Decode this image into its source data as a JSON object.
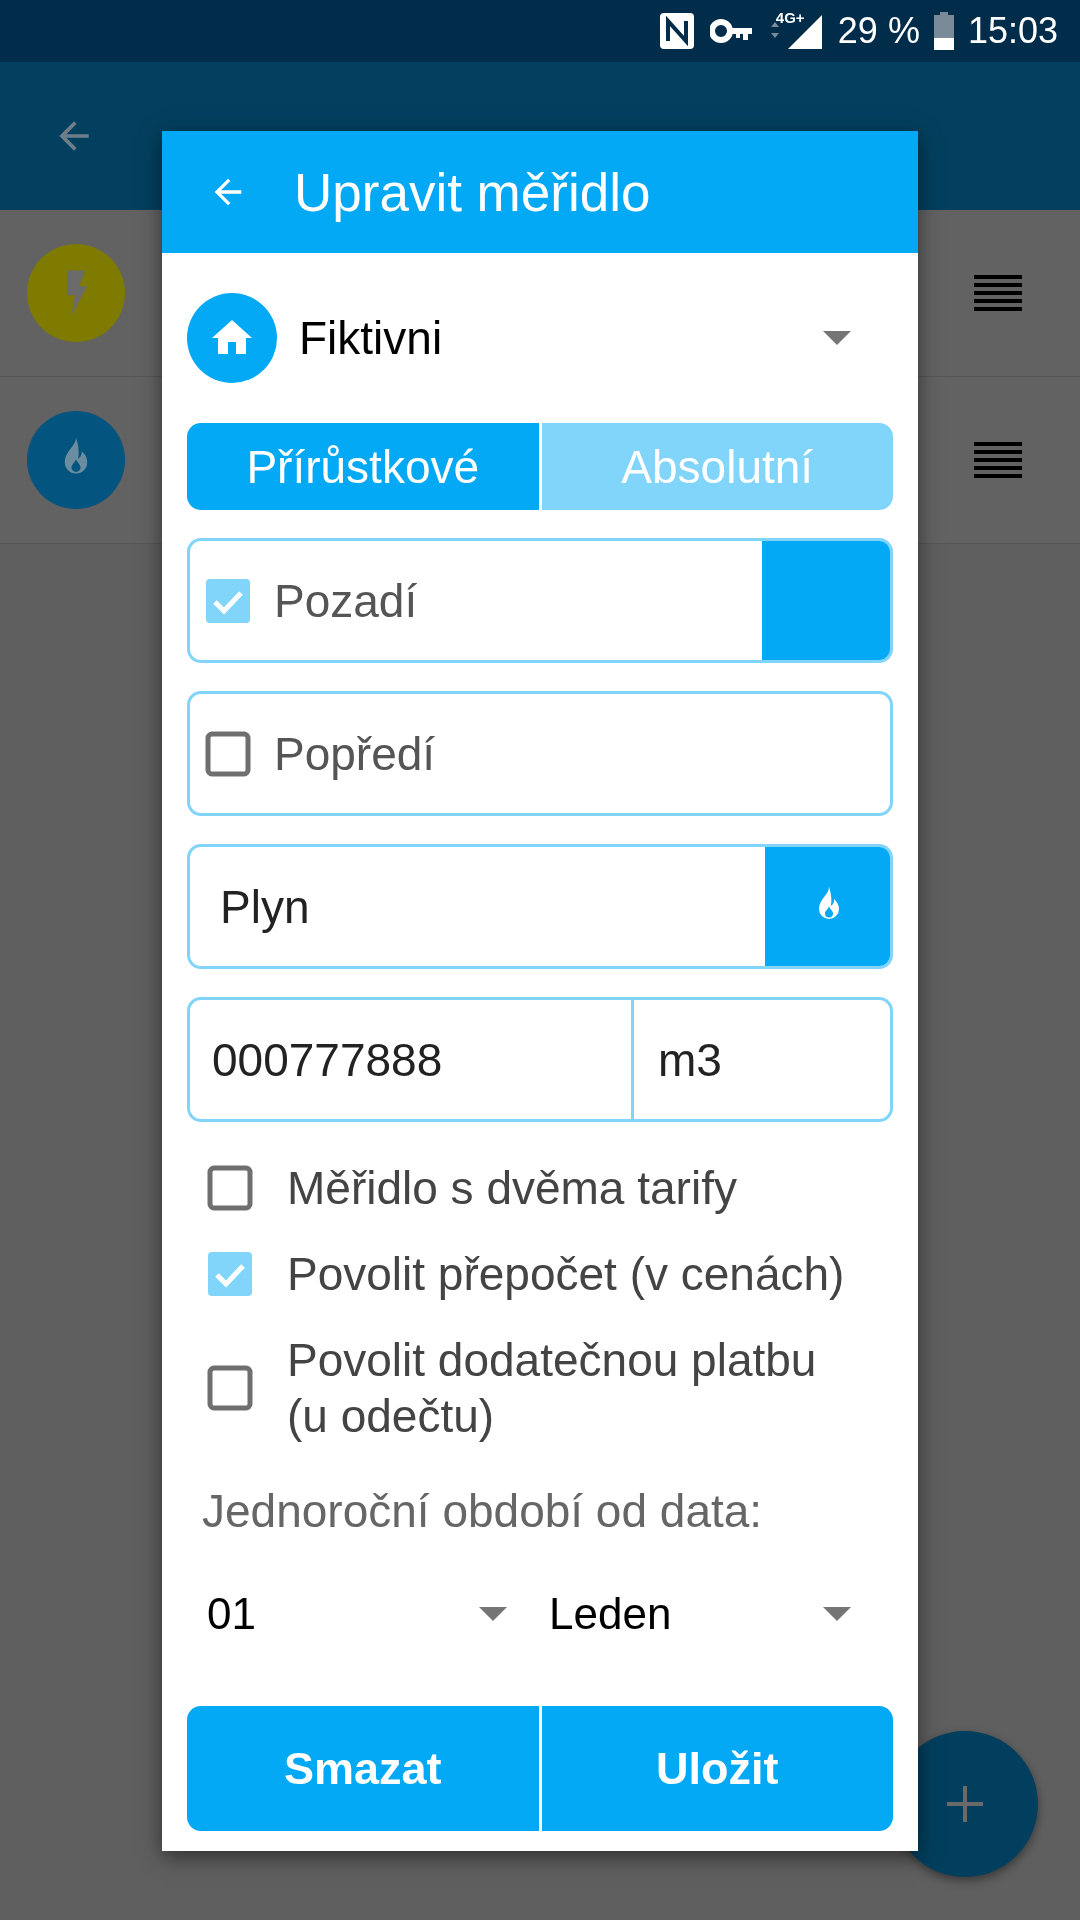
{
  "status_bar": {
    "network": "4G+",
    "battery": "29 %",
    "time": "15:03"
  },
  "meters": [
    {
      "kind": "electricity",
      "color": "#7f7a00"
    },
    {
      "kind": "gas",
      "color": "#03547e"
    }
  ],
  "dialog": {
    "title": "Upravit měřidlo",
    "place": "Fiktivni",
    "modes": [
      {
        "label": "Přírůstkové",
        "selected": true
      },
      {
        "label": "Absolutní",
        "selected": false
      }
    ],
    "background_option": {
      "label": "Pozadí",
      "checked": true
    },
    "foreground_option": {
      "label": "Popředí",
      "checked": false
    },
    "name": "Plyn",
    "number": "000777888",
    "unit": "m3",
    "options": [
      {
        "label": "Měřidlo s dvěma tarify",
        "checked": false
      },
      {
        "label": "Povolit přepočet (v cenách)",
        "checked": true
      },
      {
        "label": "Povolit dodatečnou platbu (u odečtu)",
        "checked": false
      }
    ],
    "period_label": "Jednoroční období od data:",
    "day": "01",
    "month": "Leden",
    "buttons": [
      "Smazat",
      "Uložit"
    ]
  }
}
